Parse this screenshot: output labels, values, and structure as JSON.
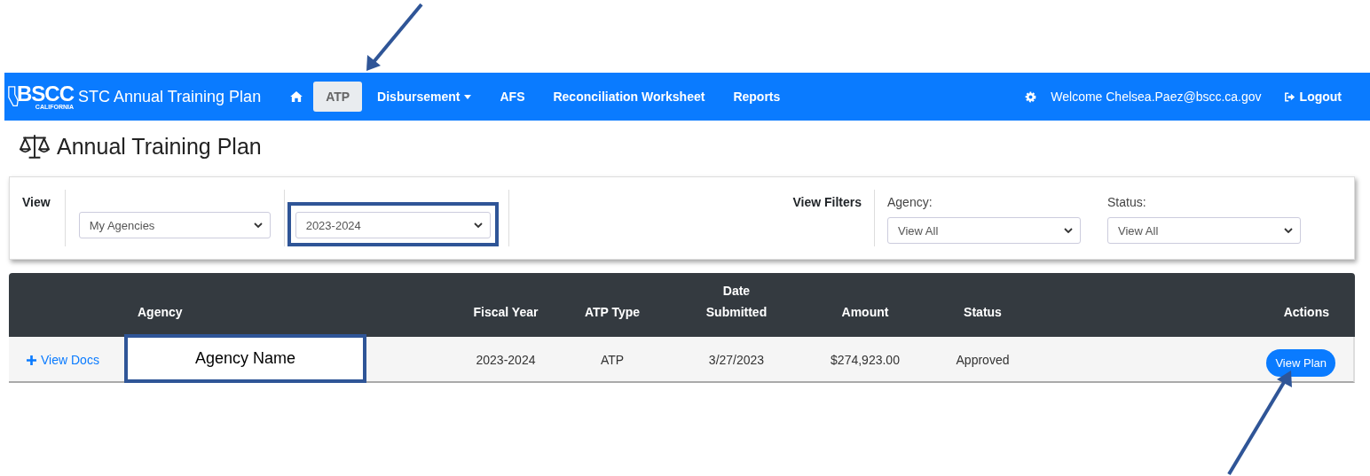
{
  "navbar": {
    "logo": {
      "text": "BSCC",
      "subtext": "CALIFORNIA"
    },
    "app_title": "STC Annual Training Plan",
    "items": [
      {
        "label": "ATP",
        "selected": true,
        "dropdown": false
      },
      {
        "label": "Disbursement",
        "selected": false,
        "dropdown": true
      },
      {
        "label": "AFS",
        "selected": false,
        "dropdown": false
      },
      {
        "label": "Reconciliation Worksheet",
        "selected": false,
        "dropdown": false
      },
      {
        "label": "Reports",
        "selected": false,
        "dropdown": false
      }
    ],
    "welcome": "Welcome Chelsea.Paez@bscc.ca.gov",
    "logout": "Logout"
  },
  "page_title": "Annual Training Plan",
  "view": {
    "label": "View",
    "scope_select": "My Agencies",
    "year_select": "2023-2024"
  },
  "filters": {
    "label": "View Filters",
    "agency": {
      "label": "Agency:",
      "value": "View All"
    },
    "status": {
      "label": "Status:",
      "value": "View All"
    }
  },
  "table": {
    "columns": [
      "",
      "Agency",
      "Fiscal Year",
      "ATP Type",
      "Date\nSubmitted",
      "Amount",
      "Status",
      "Actions"
    ],
    "rows": [
      {
        "docs_link": "View Docs",
        "agency": "Agency Name",
        "fiscal_year": "2023-2024",
        "atp_type": "ATP",
        "date_submitted": "3/27/2023",
        "amount": "$274,923.00",
        "status": "Approved",
        "action": "View Plan"
      }
    ]
  }
}
